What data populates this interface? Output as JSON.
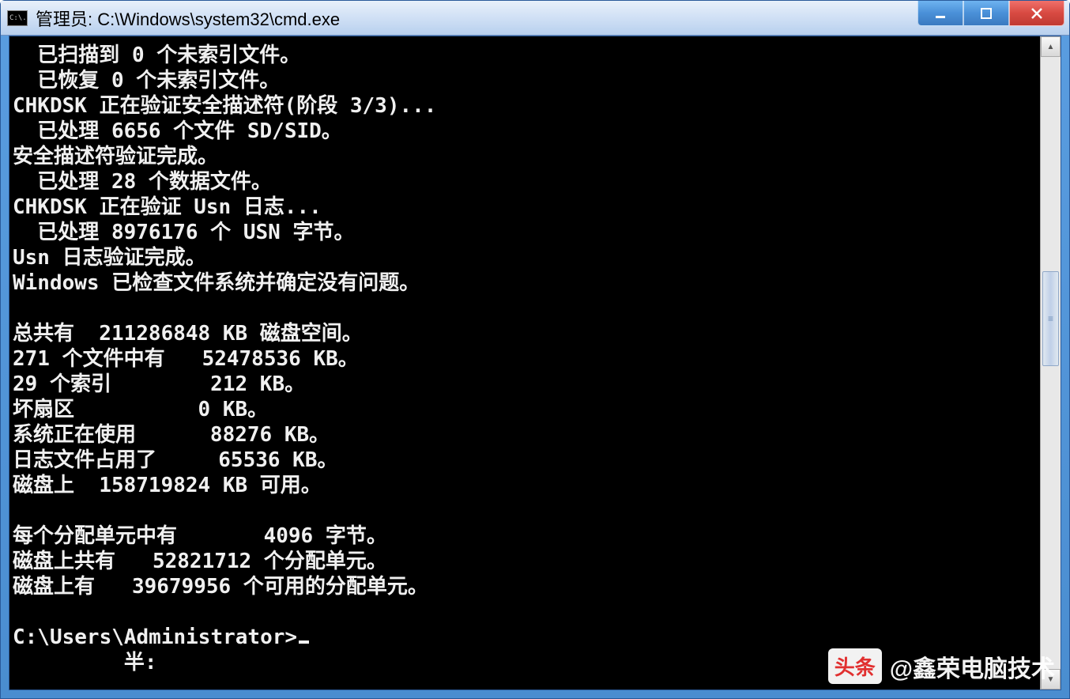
{
  "window": {
    "title": "管理员: C:\\Windows\\system32\\cmd.exe",
    "icon_label": "C:\\."
  },
  "terminal": {
    "lines": [
      "  已扫描到 0 个未索引文件。",
      "  已恢复 0 个未索引文件。",
      "CHKDSK 正在验证安全描述符(阶段 3/3)...",
      "  已处理 6656 个文件 SD/SID。",
      "安全描述符验证完成。",
      "  已处理 28 个数据文件。",
      "CHKDSK 正在验证 Usn 日志...",
      "  已处理 8976176 个 USN 字节。",
      "Usn 日志验证完成。",
      "Windows 已检查文件系统并确定没有问题。",
      "",
      "总共有  211286848 KB 磁盘空间。",
      "271 个文件中有   52478536 KB。",
      "29 个索引        212 KB。",
      "坏扇区          0 KB。",
      "系统正在使用      88276 KB。",
      "日志文件占用了     65536 KB。",
      "磁盘上  158719824 KB 可用。",
      "",
      "每个分配单元中有       4096 字节。",
      "磁盘上共有   52821712 个分配单元。",
      "磁盘上有   39679956 个可用的分配单元。",
      ""
    ],
    "prompt": "C:\\Users\\Administrator>",
    "tail": "         半:"
  },
  "watermark": {
    "logo": "头条",
    "text": "@鑫荣电脑技术"
  }
}
